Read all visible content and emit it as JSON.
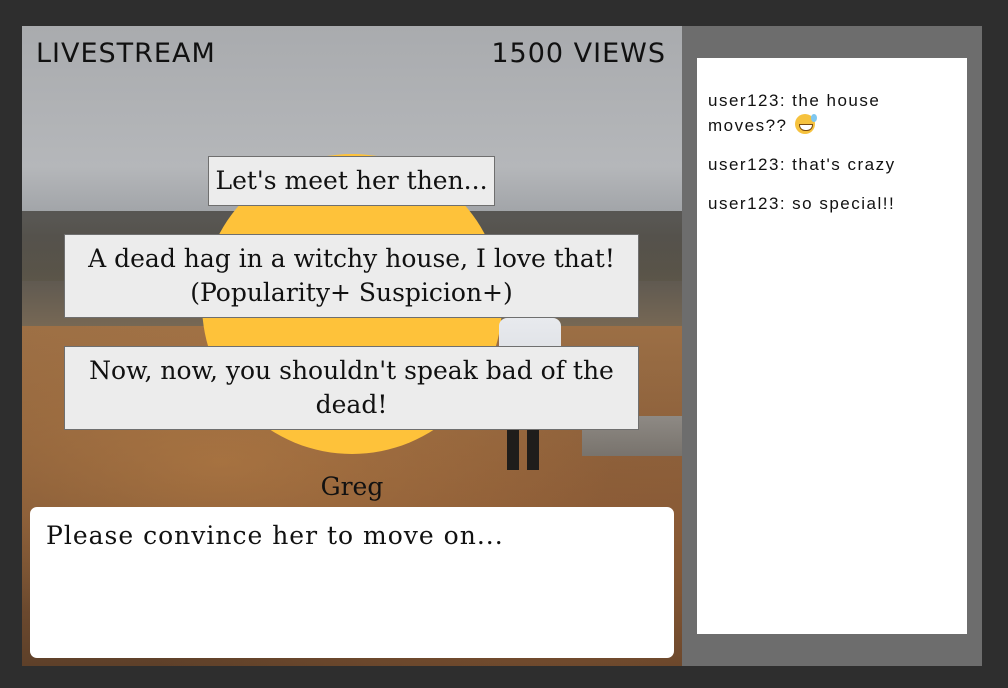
{
  "stream": {
    "label": "LIVESTREAM",
    "views": "1500 VIEWS"
  },
  "choices": [
    {
      "text": "Let's meet her then..."
    },
    {
      "line1": "A dead hag in a witchy house, I love that!",
      "line2": "(Popularity+ Suspicion+)"
    },
    {
      "line1": "Now, now, you shouldn't speak bad of the",
      "line2": "dead!"
    }
  ],
  "dialogue": {
    "speaker": "Greg",
    "text": "Please convince her to move on..."
  },
  "chat": {
    "messages": [
      {
        "user": "user123:",
        "text": "the house moves??",
        "emoji": "sweat-smile-emoji"
      },
      {
        "user": "user123:",
        "text": "that's crazy"
      },
      {
        "user": "user123:",
        "text": "so special!!"
      }
    ]
  },
  "colors": {
    "sun": "#fec23a",
    "background": "#2e2e2e",
    "sidebar": "#6d6d6d"
  }
}
